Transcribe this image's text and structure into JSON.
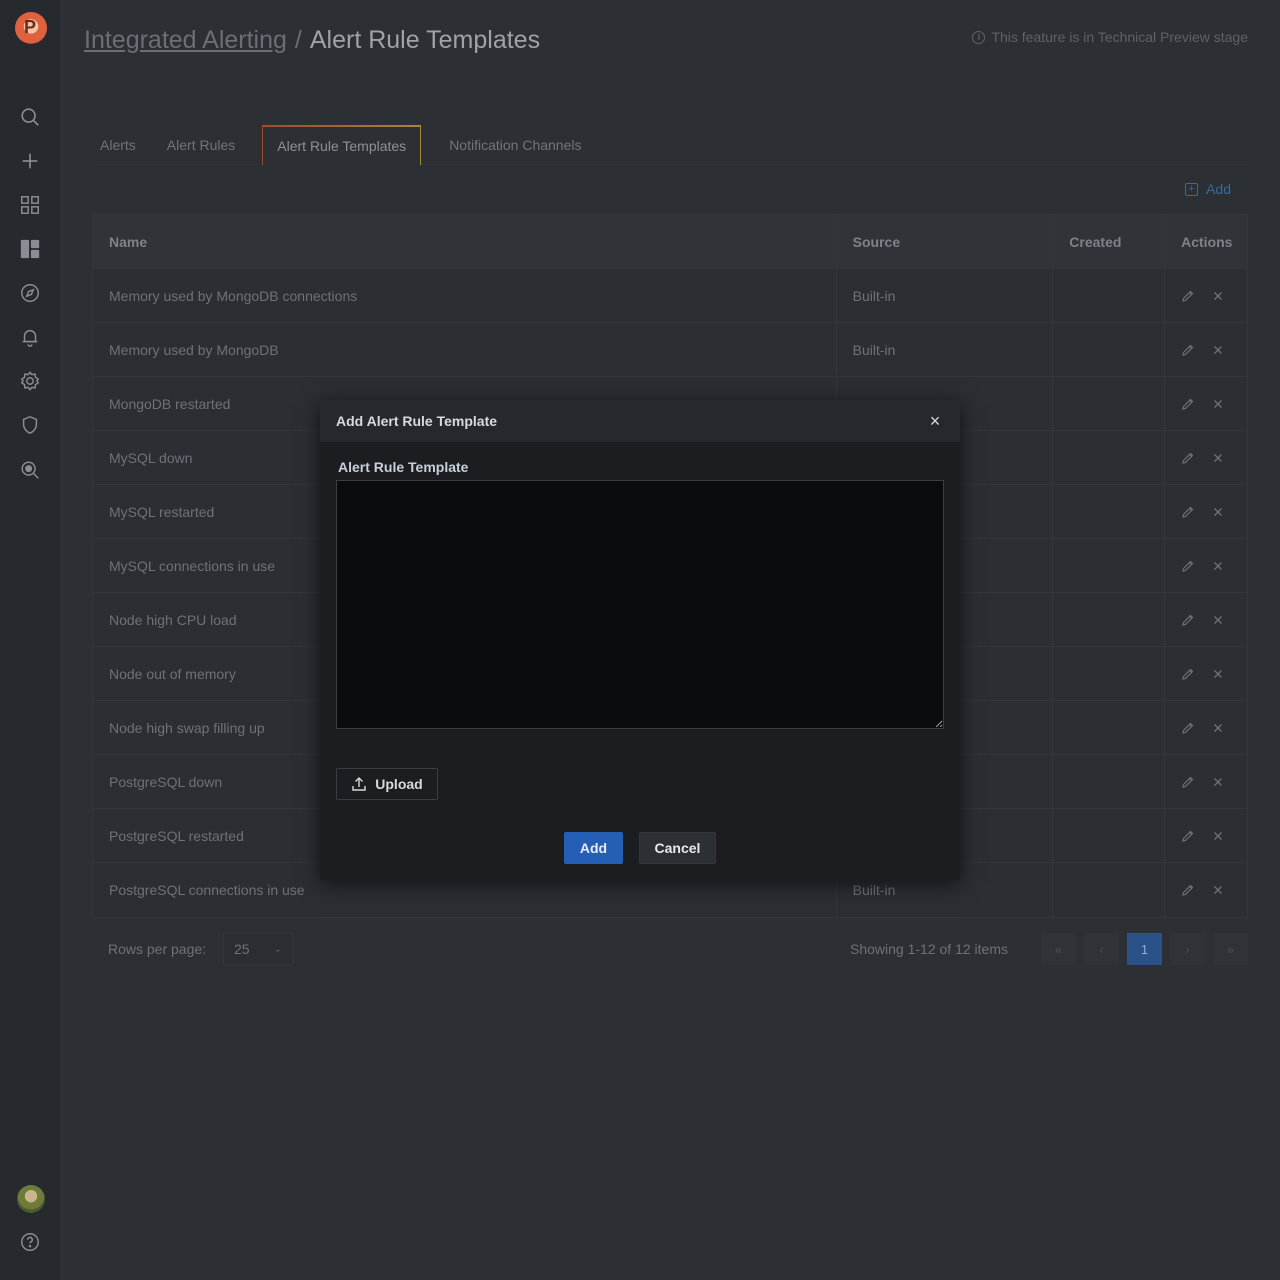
{
  "header": {
    "breadcrumb_parent": "Integrated Alerting",
    "breadcrumb_separator": "/",
    "breadcrumb_current": "Alert Rule Templates",
    "preview_note": "This feature is in Technical Preview stage"
  },
  "tabs": [
    {
      "label": "Alerts"
    },
    {
      "label": "Alert Rules"
    },
    {
      "label": "Alert Rule Templates"
    },
    {
      "label": "Notification Channels"
    }
  ],
  "add_link": "Add",
  "table": {
    "columns": [
      "Name",
      "Source",
      "Created",
      "Actions"
    ],
    "rows": [
      {
        "name": "Memory used by MongoDB connections",
        "source": "Built-in",
        "created": ""
      },
      {
        "name": "Memory used by MongoDB",
        "source": "Built-in",
        "created": ""
      },
      {
        "name": "MongoDB restarted",
        "source": "",
        "created": ""
      },
      {
        "name": "MySQL down",
        "source": "",
        "created": ""
      },
      {
        "name": "MySQL restarted",
        "source": "",
        "created": ""
      },
      {
        "name": "MySQL connections in use",
        "source": "",
        "created": ""
      },
      {
        "name": "Node high CPU load",
        "source": "",
        "created": ""
      },
      {
        "name": "Node out of memory",
        "source": "",
        "created": ""
      },
      {
        "name": "Node high swap filling up",
        "source": "",
        "created": ""
      },
      {
        "name": "PostgreSQL down",
        "source": "",
        "created": ""
      },
      {
        "name": "PostgreSQL restarted",
        "source": "",
        "created": ""
      },
      {
        "name": "PostgreSQL connections in use",
        "source": "Built-in",
        "created": ""
      }
    ]
  },
  "pagination": {
    "rows_label": "Rows per page:",
    "rows_value": "25",
    "showing": "Showing 1-12 of 12 items",
    "first": "«",
    "prev": "‹",
    "current": "1",
    "next": "›",
    "last": "»"
  },
  "modal": {
    "title": "Add Alert Rule Template",
    "close": "×",
    "field_label": "Alert Rule Template",
    "textarea_value": "",
    "upload_label": "Upload",
    "add_label": "Add",
    "cancel_label": "Cancel"
  },
  "colors": {
    "accent_blue": "#245eb5",
    "link_blue": "#2f6ea3",
    "active_tab_gradient_start": "#a04a2c",
    "active_tab_gradient_end": "#a8863a"
  }
}
